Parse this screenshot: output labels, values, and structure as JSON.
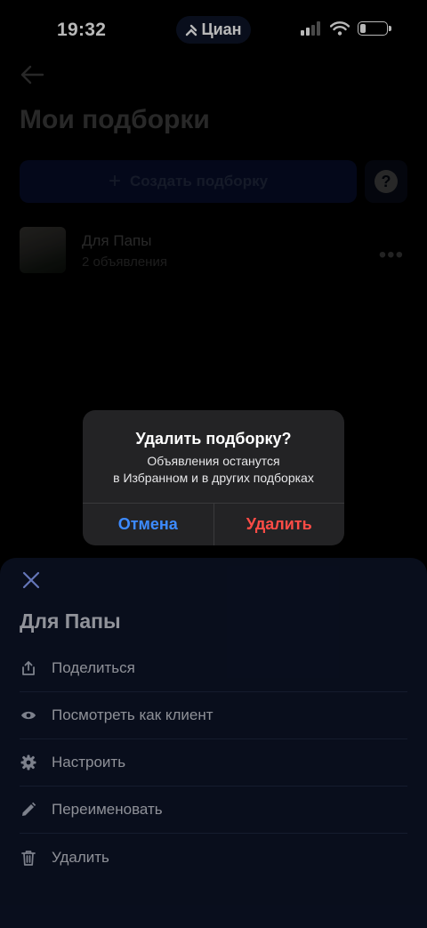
{
  "status_bar": {
    "time": "19:32",
    "app_pill_label": "Циан",
    "battery_level_percent": 20
  },
  "page": {
    "title": "Мои подборки",
    "create_button_label": "Создать подборку",
    "help_button_label": "?",
    "collections": [
      {
        "name": "Для Папы",
        "meta": "2 объявления"
      }
    ]
  },
  "alert": {
    "title": "Удалить подборку?",
    "message_line1": "Объявления останутся",
    "message_line2": "в Избранном и в других подборках",
    "cancel_label": "Отмена",
    "delete_label": "Удалить"
  },
  "sheet": {
    "title": "Для Папы",
    "items": [
      {
        "label": "Поделиться",
        "icon": "share-icon"
      },
      {
        "label": "Посмотреть как клиент",
        "icon": "eye-icon"
      },
      {
        "label": "Настроить",
        "icon": "gear-icon"
      },
      {
        "label": "Переименовать",
        "icon": "pencil-icon"
      },
      {
        "label": "Удалить",
        "icon": "trash-icon"
      }
    ]
  },
  "colors": {
    "accent_blue": "#3d8bff",
    "danger_red": "#ff4c46",
    "sheet_bg": "#0d1428",
    "alert_bg": "#232325"
  }
}
